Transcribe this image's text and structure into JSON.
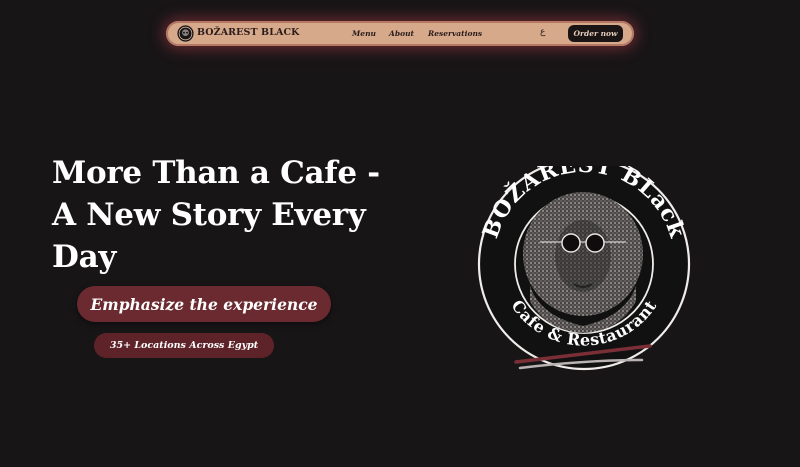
{
  "nav": {
    "brand": "BOŽAREST BLACK",
    "links": [
      "Menu",
      "About",
      "Reservations"
    ],
    "lang_label": "ع",
    "order_label": "Order now"
  },
  "hero": {
    "title_lines": [
      "More Than a Cafe -",
      "A New Story Every",
      "Day"
    ],
    "primary_pill": "Emphasize the experience",
    "secondary_pill": "35+ Locations Across Egypt"
  },
  "emblem": {
    "top_text": "BOŽAREST BLack",
    "bottom_text": "Cafe & Restaurant"
  },
  "colors": {
    "background": "#181517",
    "nav_bg": "#d7a98b",
    "accent": "#6a2a30"
  },
  "icons": {
    "logo": "emblem-logo-icon",
    "portrait": "portrait-with-sunglasses-icon"
  }
}
